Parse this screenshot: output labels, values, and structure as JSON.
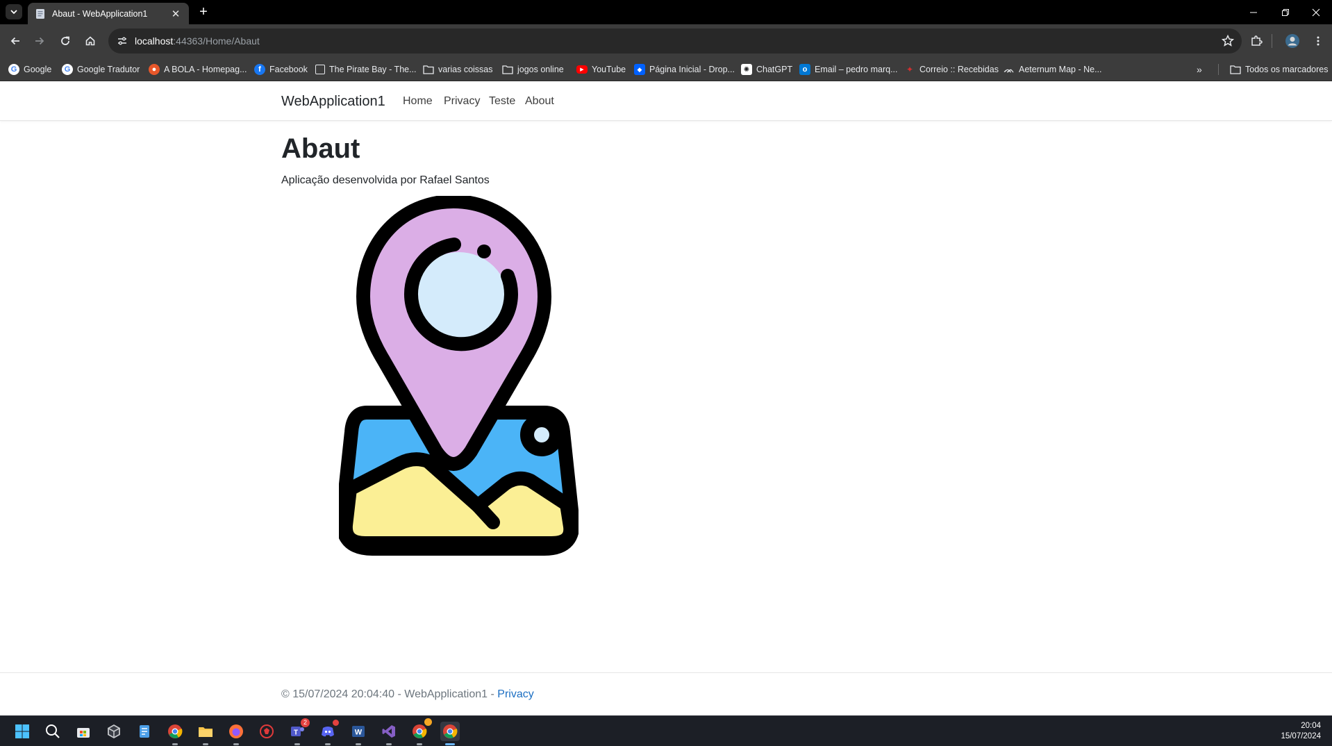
{
  "browser": {
    "tab_title": "Abaut - WebApplication1",
    "url_host": "localhost",
    "url_rest": ":44363/Home/Abaut",
    "bookmarks": [
      {
        "label": "Google",
        "icon": "google-icon"
      },
      {
        "label": "Google Tradutor",
        "icon": "google-icon"
      },
      {
        "label": "A BOLA - Homepag...",
        "icon": "abola-icon"
      },
      {
        "label": "Facebook",
        "icon": "facebook-icon"
      },
      {
        "label": "The Pirate Bay - The...",
        "icon": "piratebay-icon"
      },
      {
        "label": "varias coissas",
        "icon": "folder-icon"
      },
      {
        "label": "jogos online",
        "icon": "folder-icon"
      },
      {
        "label": "YouTube",
        "icon": "youtube-icon"
      },
      {
        "label": "Página Inicial - Drop...",
        "icon": "dropbox-icon"
      },
      {
        "label": "ChatGPT",
        "icon": "chatgpt-icon"
      },
      {
        "label": "Email – pedro marq...",
        "icon": "outlook-icon"
      },
      {
        "label": "Correio :: Recebidas",
        "icon": "mail-icon"
      },
      {
        "label": "Aeternum Map - Ne...",
        "icon": "map-icon"
      }
    ],
    "all_bookmarks_label": "Todos os marcadores"
  },
  "site": {
    "brand": "WebApplication1",
    "nav": [
      "Home",
      "Privacy",
      "Teste",
      "About"
    ],
    "title": "Abaut",
    "subtitle": "Aplicação desenvolvida por Rafael Santos",
    "footer_text": "© 15/07/2024 20:04:40 - WebApplication1 - ",
    "footer_link": "Privacy"
  },
  "taskbar": {
    "time": "20:04",
    "date": "15/07/2024",
    "badges": {
      "teams": "2"
    }
  },
  "colors": {
    "pin": "#dbaee6",
    "lens": "#d4ebfb",
    "sky": "#4bb4f7",
    "sand": "#fbef95",
    "link": "#1b6ec2"
  }
}
